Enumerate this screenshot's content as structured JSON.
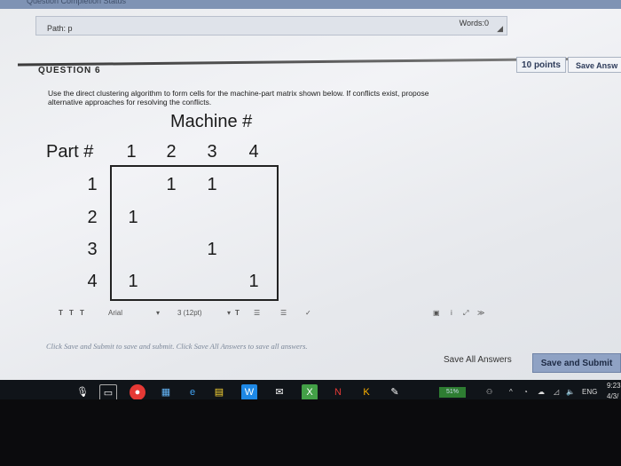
{
  "editor": {
    "path_label": "Path: p",
    "words_label": "Words:0"
  },
  "question": {
    "title": "QUESTION 6",
    "points": "10 points",
    "save_answer": "Save Answ",
    "text_line1": "Use the direct clustering algorithm to form cells for the machine-part matrix shown below. If conflicts exist, propose",
    "text_line2": "alternative approaches for resolving the conflicts."
  },
  "matrix": {
    "header": "Machine #",
    "row_label": "Part #",
    "columns": [
      "1",
      "2",
      "3",
      "4"
    ],
    "rows": [
      {
        "part": "1",
        "cells": [
          "",
          "1",
          "1",
          ""
        ]
      },
      {
        "part": "2",
        "cells": [
          "1",
          "",
          "",
          ""
        ]
      },
      {
        "part": "3",
        "cells": [
          "",
          "",
          "1",
          ""
        ]
      },
      {
        "part": "4",
        "cells": [
          "1",
          "",
          "",
          "1"
        ]
      }
    ]
  },
  "toolbar": {
    "text_buttons": [
      "T",
      "T",
      "T"
    ],
    "font": "Arial",
    "size": "3 (12pt)"
  },
  "footer": {
    "hint": "Click Save and Submit to save and submit. Click Save All Answers to save all answers.",
    "save_all": "Save All Answers",
    "save_submit": "Save and Submit"
  },
  "taskbar": {
    "battery": "51%",
    "language": "ENG",
    "time": "9:23",
    "date": "4/3/"
  },
  "colors": {
    "accent": "#8fa2c4",
    "taskbar": "#101419"
  }
}
